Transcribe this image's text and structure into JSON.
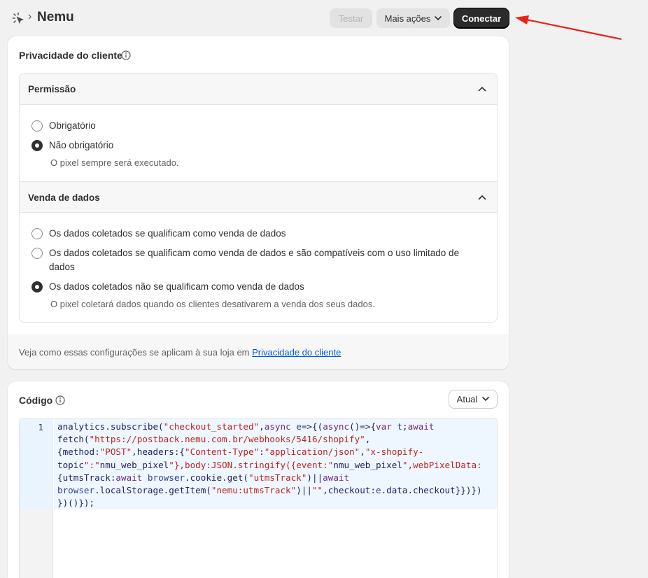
{
  "header": {
    "title": "Nemu",
    "test_label": "Testar",
    "more_label": "Mais ações",
    "connect_label": "Conectar"
  },
  "privacy": {
    "title": "Privacidade do cliente",
    "permission": {
      "heading": "Permissão",
      "options": [
        "Obrigatório",
        "Não obrigatório"
      ],
      "selected": "Não obrigatório",
      "help": "O pixel sempre será executado."
    },
    "data_sale": {
      "heading": "Venda de dados",
      "options": [
        "Os dados coletados se qualificam como venda de dados",
        "Os dados coletados se qualificam como venda de dados e são compatíveis com o uso limitado de dados",
        "Os dados coletados não se qualificam como venda de dados"
      ],
      "selected": "Os dados coletados não se qualificam como venda de dados",
      "help": "O pixel coletará dados quando os clientes desativarem a venda dos seus dados."
    },
    "footer_text": "Veja como essas configurações se aplicam à sua loja em ",
    "footer_link": "Privacidade do cliente"
  },
  "code": {
    "title": "Código",
    "version_label": "Atual",
    "line_number": "1",
    "source": "analytics.subscribe(\"checkout_started\",async e=>{(async()=>{var t;await fetch(\"https://postback.nemu.com.br/webhooks/5416/shopify\",{method:\"POST\",headers:{\"Content-Type\":\"application/json\",\"x-shopify-topic\":\"nmu_web_pixel\"},body:JSON.stringify({event:\"nmu_web_pixel\",webPixelData:{utmsTrack:await browser.cookie.get(\"utmsTrack\")||await browser.localStorage.getItem(\"nemu:utmsTrack\")||\"\",checkout:e.data.checkout}})})})()});"
  },
  "colors": {
    "accent_dark": "#2b2b2b",
    "link": "#005bd3",
    "annotation_arrow": "#e8231b"
  }
}
